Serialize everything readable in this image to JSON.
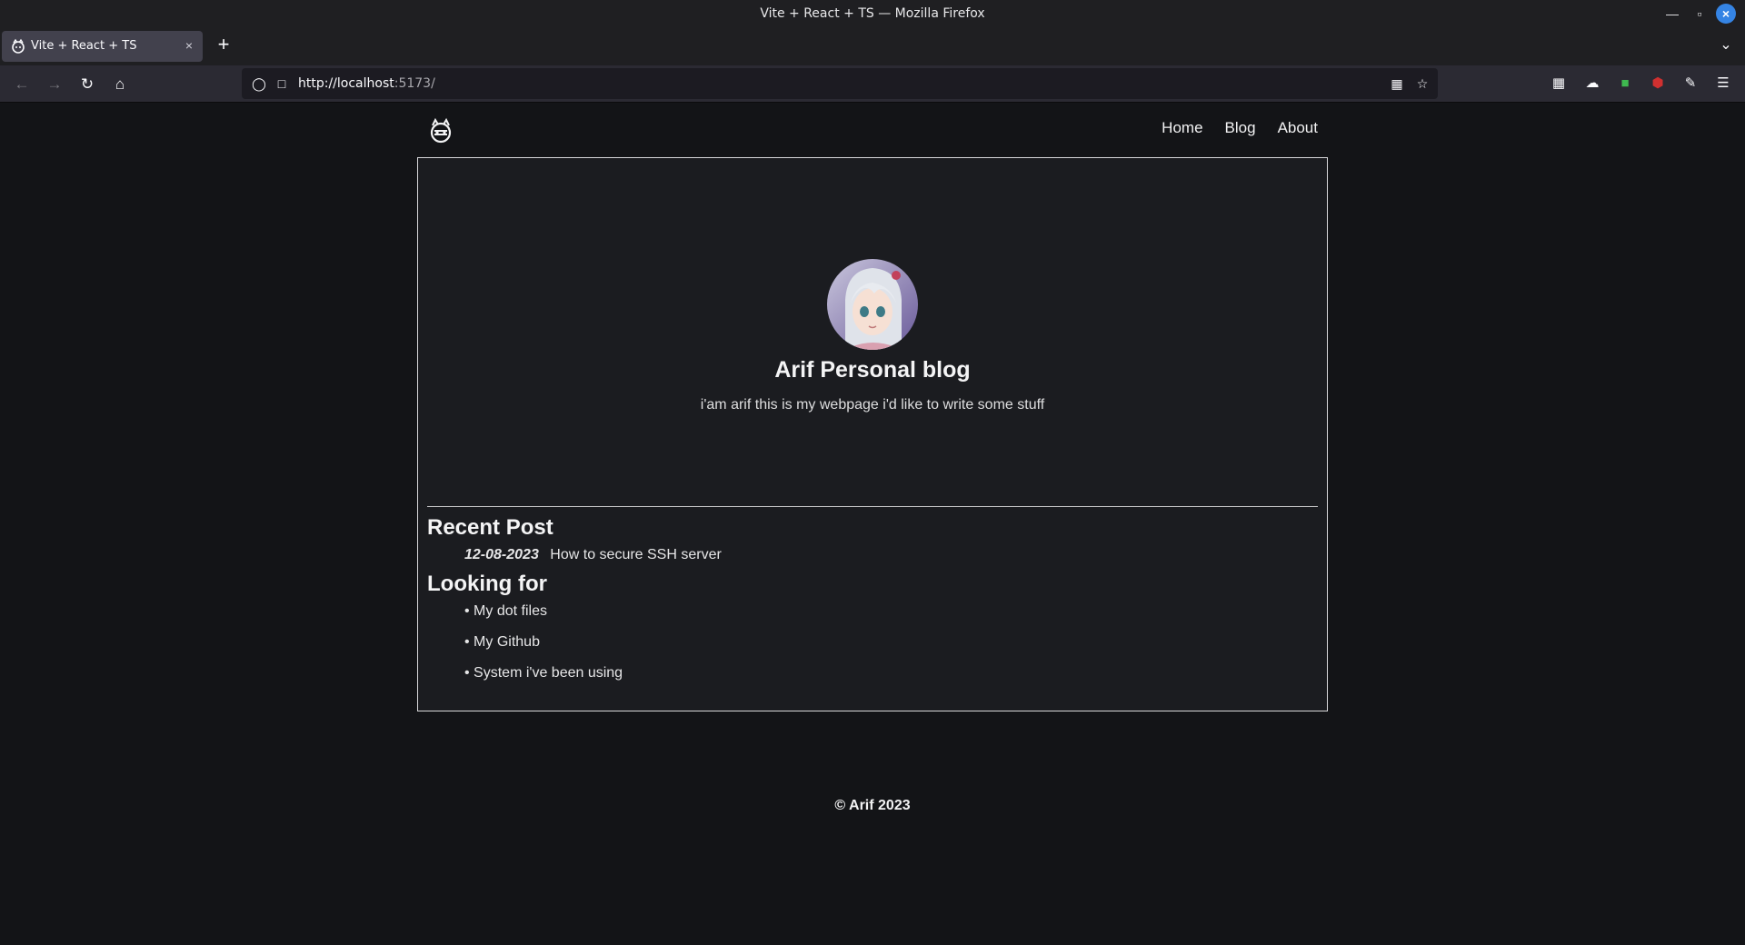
{
  "window": {
    "title": "Vite + React + TS — Mozilla Firefox"
  },
  "tabs": [
    {
      "label": "Vite + React + TS",
      "close": "×"
    }
  ],
  "newtab": "+",
  "urlbar": {
    "host": "http://localhost",
    "rest": ":5173/"
  },
  "site": {
    "nav": [
      "Home",
      "Blog",
      "About"
    ],
    "title": "Arif Personal blog",
    "subtitle": "i'am arif this is my webpage i'd like to write some stuff",
    "recent_heading": "Recent Post",
    "recent_posts": [
      {
        "date": "12-08-2023",
        "title": "How to secure SSH server"
      }
    ],
    "looking_heading": "Looking for",
    "looking_items": [
      "• My dot files",
      "• My Github",
      "• System i've been using"
    ],
    "footer": "© Arif 2023"
  },
  "colors": {
    "accent": "#3584e4",
    "page_bg": "#131417",
    "card_border": "#d8d8da"
  }
}
